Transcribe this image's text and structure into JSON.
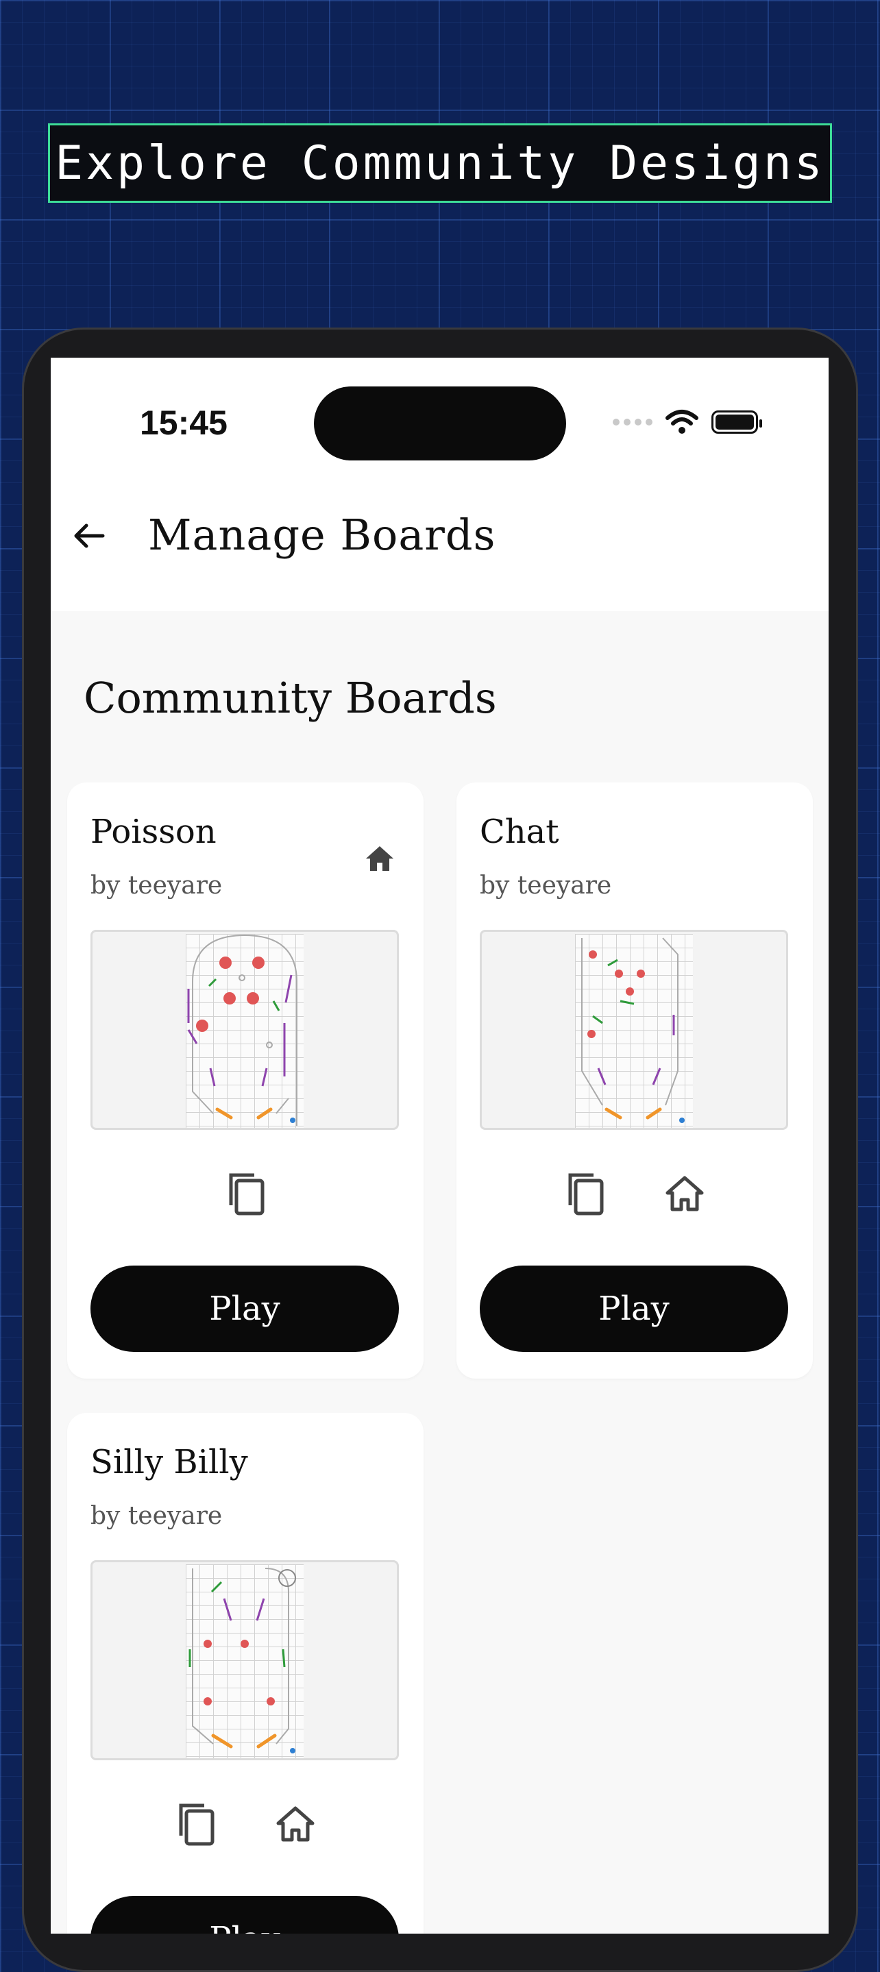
{
  "banner": {
    "text": "Explore Community Designs"
  },
  "status_bar": {
    "time": "15:45"
  },
  "header": {
    "title": "Manage Boards"
  },
  "section": {
    "title": "Community Boards"
  },
  "boards": [
    {
      "title": "Poisson",
      "author": "by teeyare",
      "play_label": "Play",
      "icons": [
        "home-icon",
        "copy-icon"
      ]
    },
    {
      "title": "Chat",
      "author": "by teeyare",
      "play_label": "Play",
      "icons": [
        "copy-icon",
        "home-outline-icon"
      ]
    },
    {
      "title": "Silly Billy",
      "author": "by teeyare",
      "play_label": "Play",
      "icons": [
        "copy-icon",
        "home-outline-icon"
      ]
    }
  ],
  "colors": {
    "background": "#0d2257",
    "accent_border": "#3ddc97",
    "bumper": "#e05555",
    "flipper": "#f0952a",
    "rail": "#8e44ad",
    "kicker": "#2e9b3a"
  }
}
